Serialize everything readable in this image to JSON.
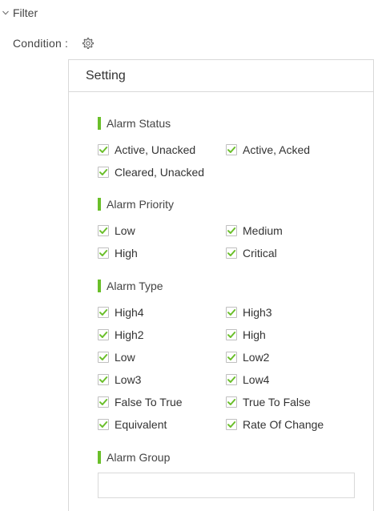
{
  "filter": {
    "title": "Filter"
  },
  "condition": {
    "label": "Condition :"
  },
  "panel": {
    "title": "Setting"
  },
  "accent_color": "#6abf2a",
  "sections": {
    "status": {
      "title": "Alarm Status",
      "items": [
        {
          "label": "Active, Unacked",
          "checked": true
        },
        {
          "label": "Active, Acked",
          "checked": true
        },
        {
          "label": "Cleared, Unacked",
          "checked": true
        }
      ]
    },
    "priority": {
      "title": "Alarm Priority",
      "items": [
        {
          "label": "Low",
          "checked": true
        },
        {
          "label": "Medium",
          "checked": true
        },
        {
          "label": "High",
          "checked": true
        },
        {
          "label": "Critical",
          "checked": true
        }
      ]
    },
    "type": {
      "title": "Alarm Type",
      "items": [
        {
          "label": "High4",
          "checked": true
        },
        {
          "label": "High3",
          "checked": true
        },
        {
          "label": "High2",
          "checked": true
        },
        {
          "label": "High",
          "checked": true
        },
        {
          "label": "Low",
          "checked": true
        },
        {
          "label": "Low2",
          "checked": true
        },
        {
          "label": "Low3",
          "checked": true
        },
        {
          "label": "Low4",
          "checked": true
        },
        {
          "label": "False To True",
          "checked": true
        },
        {
          "label": "True To False",
          "checked": true
        },
        {
          "label": "Equivalent",
          "checked": true
        },
        {
          "label": "Rate Of Change",
          "checked": true
        }
      ]
    },
    "group": {
      "title": "Alarm Group",
      "value": "",
      "placeholder": ""
    }
  }
}
